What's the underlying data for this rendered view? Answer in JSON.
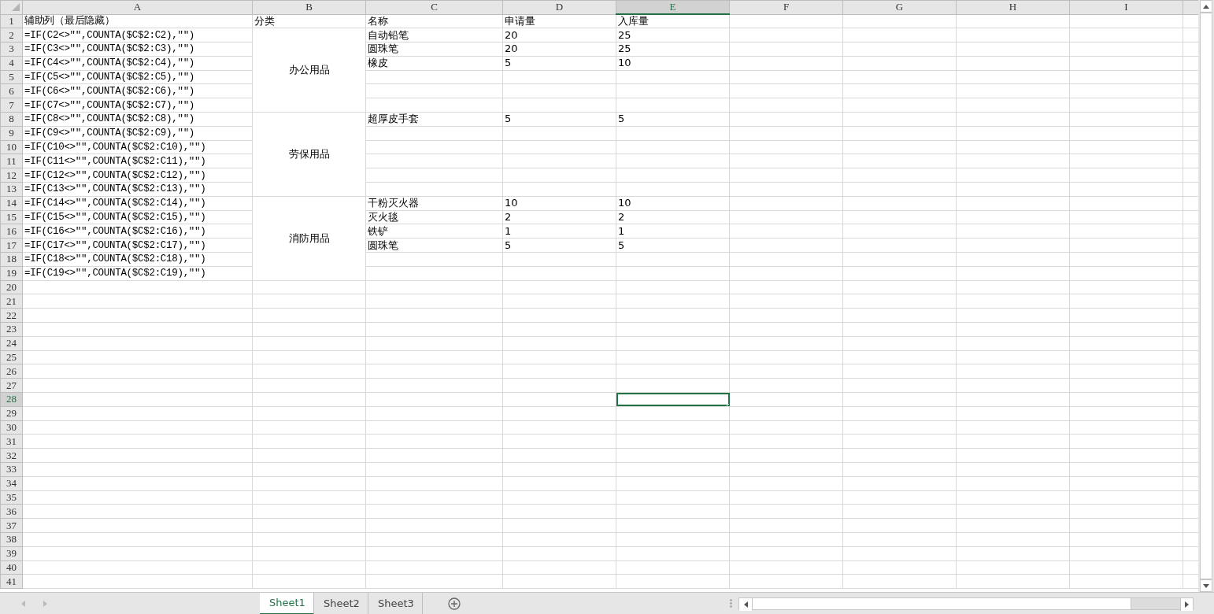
{
  "columns": [
    {
      "label": "A",
      "selected": false
    },
    {
      "label": "B",
      "selected": false
    },
    {
      "label": "C",
      "selected": false
    },
    {
      "label": "D",
      "selected": false
    },
    {
      "label": "E",
      "selected": true
    },
    {
      "label": "F",
      "selected": false
    },
    {
      "label": "G",
      "selected": false
    },
    {
      "label": "H",
      "selected": false
    },
    {
      "label": "I",
      "selected": false
    }
  ],
  "header_row": {
    "a": "辅助列（最后隐藏）",
    "b": "分类",
    "c": "名称",
    "d": "申请量",
    "e": "入库量"
  },
  "groups": [
    {
      "category": "办公用品",
      "rows": [
        {
          "a": "=IF(C2<>\"\",COUNTA($C$2:C2),\"\")",
          "c": "自动铅笔",
          "d": "20",
          "e": "25"
        },
        {
          "a": "=IF(C3<>\"\",COUNTA($C$2:C3),\"\")",
          "c": "圆珠笔",
          "d": "20",
          "e": "25"
        },
        {
          "a": "=IF(C4<>\"\",COUNTA($C$2:C4),\"\")",
          "c": "橡皮",
          "d": "5",
          "e": "10"
        },
        {
          "a": "=IF(C5<>\"\",COUNTA($C$2:C5),\"\")"
        },
        {
          "a": "=IF(C6<>\"\",COUNTA($C$2:C6),\"\")"
        },
        {
          "a": "=IF(C7<>\"\",COUNTA($C$2:C7),\"\")"
        }
      ]
    },
    {
      "category": "劳保用品",
      "rows": [
        {
          "a": "=IF(C8<>\"\",COUNTA($C$2:C8),\"\")",
          "c": "超厚皮手套",
          "d": "5",
          "e": "5"
        },
        {
          "a": "=IF(C9<>\"\",COUNTA($C$2:C9),\"\")"
        },
        {
          "a": "=IF(C10<>\"\",COUNTA($C$2:C10),\"\")"
        },
        {
          "a": "=IF(C11<>\"\",COUNTA($C$2:C11),\"\")"
        },
        {
          "a": "=IF(C12<>\"\",COUNTA($C$2:C12),\"\")"
        },
        {
          "a": "=IF(C13<>\"\",COUNTA($C$2:C13),\"\")"
        }
      ]
    },
    {
      "category": "消防用品",
      "rows": [
        {
          "a": "=IF(C14<>\"\",COUNTA($C$2:C14),\"\")",
          "c": "干粉灭火器",
          "d": "10",
          "e": "10"
        },
        {
          "a": "=IF(C15<>\"\",COUNTA($C$2:C15),\"\")",
          "c": "灭火毯",
          "d": "2",
          "e": "2"
        },
        {
          "a": "=IF(C16<>\"\",COUNTA($C$2:C16),\"\")",
          "c": "铁铲",
          "d": "1",
          "e": "1"
        },
        {
          "a": "=IF(C17<>\"\",COUNTA($C$2:C17),\"\")",
          "c": "圆珠笔",
          "d": "5",
          "e": "5"
        },
        {
          "a": "=IF(C18<>\"\",COUNTA($C$2:C18),\"\")"
        },
        {
          "a": "=IF(C19<>\"\",COUNTA($C$2:C19),\"\")"
        }
      ]
    }
  ],
  "row_numbers": [
    {
      "label": "1",
      "selected": false
    },
    {
      "label": "2",
      "selected": false
    },
    {
      "label": "3",
      "selected": false
    },
    {
      "label": "4",
      "selected": false
    },
    {
      "label": "5",
      "selected": false
    },
    {
      "label": "6",
      "selected": false
    },
    {
      "label": "7",
      "selected": false
    },
    {
      "label": "8",
      "selected": false
    },
    {
      "label": "9",
      "selected": false
    },
    {
      "label": "10",
      "selected": false
    },
    {
      "label": "11",
      "selected": false
    },
    {
      "label": "12",
      "selected": false
    },
    {
      "label": "13",
      "selected": false
    },
    {
      "label": "14",
      "selected": false
    },
    {
      "label": "15",
      "selected": false
    },
    {
      "label": "16",
      "selected": false
    },
    {
      "label": "17",
      "selected": false
    },
    {
      "label": "18",
      "selected": false
    },
    {
      "label": "19",
      "selected": false
    },
    {
      "label": "20",
      "selected": false
    },
    {
      "label": "21",
      "selected": false
    },
    {
      "label": "22",
      "selected": false
    },
    {
      "label": "23",
      "selected": false
    },
    {
      "label": "24",
      "selected": false
    },
    {
      "label": "25",
      "selected": false
    },
    {
      "label": "26",
      "selected": false
    },
    {
      "label": "27",
      "selected": false
    },
    {
      "label": "28",
      "selected": true
    },
    {
      "label": "29",
      "selected": false
    },
    {
      "label": "30",
      "selected": false
    },
    {
      "label": "31",
      "selected": false
    },
    {
      "label": "32",
      "selected": false
    },
    {
      "label": "33",
      "selected": false
    },
    {
      "label": "34",
      "selected": false
    },
    {
      "label": "35",
      "selected": false
    },
    {
      "label": "36",
      "selected": false
    },
    {
      "label": "37",
      "selected": false
    },
    {
      "label": "38",
      "selected": false
    },
    {
      "label": "39",
      "selected": false
    },
    {
      "label": "40",
      "selected": false
    },
    {
      "label": "41",
      "selected": false
    }
  ],
  "sheet_tabs": [
    {
      "label": "Sheet1",
      "selected": true
    },
    {
      "label": "Sheet2",
      "selected": false
    },
    {
      "label": "Sheet3",
      "selected": false
    }
  ]
}
